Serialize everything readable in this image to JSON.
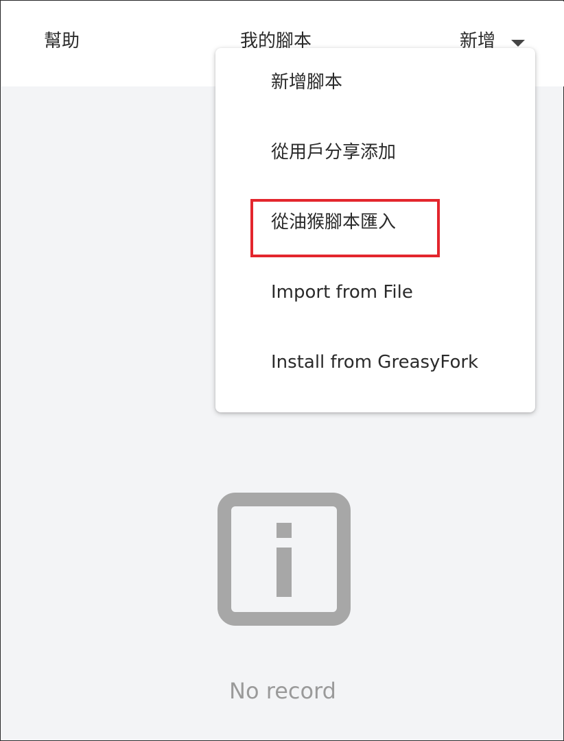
{
  "header": {
    "help_label": "幫助",
    "my_scripts_label": "我的腳本",
    "new_label": "新增",
    "dropdown_icon": "caret-down-icon"
  },
  "menu": {
    "items": [
      {
        "label": "新增腳本"
      },
      {
        "label": "從用戶分享添加"
      },
      {
        "label": "從油猴腳本匯入",
        "highlighted": true
      },
      {
        "label": "Import from File"
      },
      {
        "label": "Install from GreasyFork"
      }
    ]
  },
  "empty_state": {
    "icon": "info-icon",
    "text": "No record"
  },
  "colors": {
    "page_background": "#f3f4f6",
    "header_background": "#ffffff",
    "highlight_border": "#e3262d",
    "icon_gray": "#a7a7a7",
    "empty_text": "#9a9a9a"
  }
}
